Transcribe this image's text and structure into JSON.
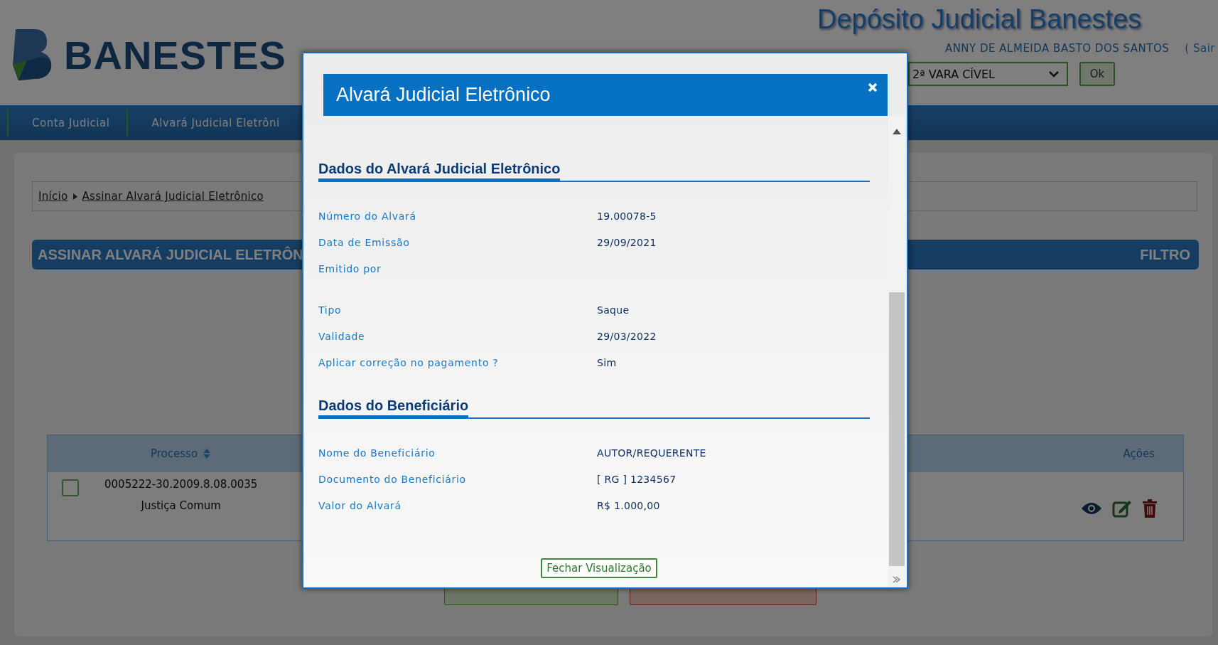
{
  "header": {
    "logo": "BANESTES",
    "app_title": "Depósito Judicial Banestes",
    "user_name": "ANNY DE ALMEIDA BASTO DOS SANTOS",
    "logout": "( Sair",
    "court_select": {
      "value": "2ª VARA CÍVEL"
    },
    "ok_button": "Ok"
  },
  "nav": {
    "items": [
      {
        "label": "Conta Judicial"
      },
      {
        "label": "Alvará Judicial Eletrôni"
      }
    ]
  },
  "breadcrumb": [
    {
      "label": "Início"
    },
    {
      "label": "Assinar Alvará Judicial Eletrônico"
    }
  ],
  "page_title": "ASSINAR ALVARÁ JUDICIAL ELETRÔN",
  "filter_label": "FILTRO",
  "table": {
    "columns": [
      {
        "label": "Processo",
        "sortable": true
      },
      {
        "label": "Ações",
        "sortable": false
      }
    ],
    "rows": [
      {
        "checked": false,
        "process": "0005222-30.2009.8.08.0035",
        "court": "Justiça Comum"
      }
    ]
  },
  "modal": {
    "title": "Alvará Judicial Eletrônico",
    "sections": [
      {
        "title": "Dados do Alvará Judicial Eletrônico",
        "fields": [
          {
            "label": "Número do Alvará",
            "value": "19.00078-5"
          },
          {
            "label": "Data de Emissão",
            "value": "29/09/2021"
          },
          {
            "label": "Emitido por"
          },
          {
            "label": "Tipo",
            "value": "Saque"
          },
          {
            "label": "Validade",
            "value": "29/03/2022"
          },
          {
            "label": "Aplicar correção no pagamento ?",
            "value": "Sim"
          }
        ]
      },
      {
        "title": "Dados do Beneficiário",
        "fields": [
          {
            "label": "Nome do Beneficiário",
            "value": "AUTOR/REQUERENTE"
          },
          {
            "label": "Documento do Beneficiário",
            "value": "[ RG ] 1234567"
          },
          {
            "label": "Valor do Alvará",
            "value": "R$ 1.000,00"
          }
        ]
      }
    ],
    "close_button": "Fechar Visualização"
  }
}
